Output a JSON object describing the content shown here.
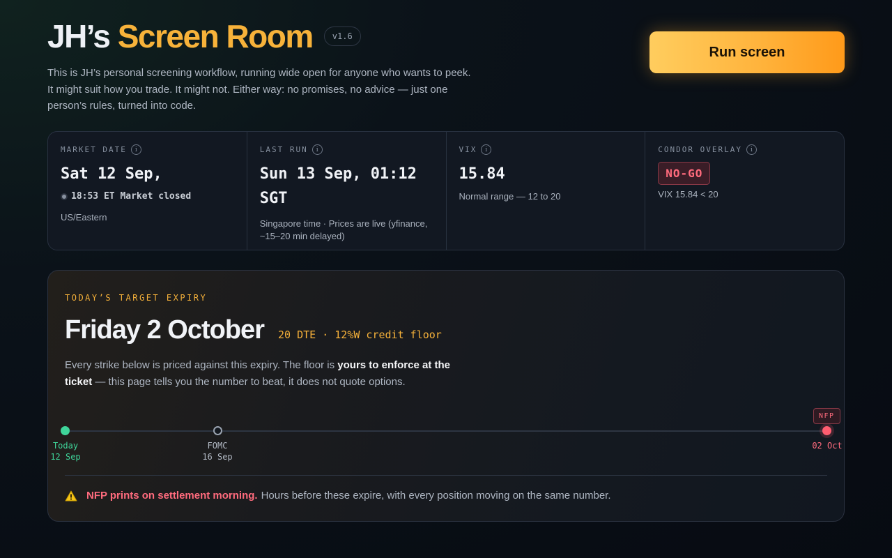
{
  "header": {
    "title_prefix": "JH’s",
    "title_accent": "Screen Room",
    "version": "v1.6",
    "intro": "This is JH’s personal screening workflow, running wide open for anyone who wants to peek. It might suit how you trade. It might not. Either way: no promises, no advice — just one person’s rules, turned into code."
  },
  "actions": {
    "run_label": "Run screen"
  },
  "stats": {
    "market_date": {
      "label": "MARKET DATE",
      "value": "Sat 12 Sep,",
      "status": "18:53 ET Market closed",
      "timezone": "US/Eastern"
    },
    "last_run": {
      "label": "LAST RUN",
      "value": "Sun 13 Sep, 01:12 SGT",
      "sub": "Singapore time · Prices are live (yfinance, ~15–20 min delayed)"
    },
    "vix": {
      "label": "VIX",
      "value": "15.84",
      "sub": "Normal range — 12 to 20"
    },
    "condor": {
      "label": "CONDOR OVERLAY",
      "badge": "NO-GO",
      "sub": "VIX 15.84 < 20"
    }
  },
  "expiry": {
    "label": "TODAY’S TARGET EXPIRY",
    "date": "Friday 2 October",
    "meta": "20 DTE · 12%W credit floor",
    "desc_before": "Every strike below is priced against this expiry. The floor is ",
    "desc_strong": "yours to enforce at the ticket",
    "desc_after": " — this page tells you the number to beat, it does not quote options.",
    "timeline": {
      "today_label": "Today",
      "today_date": "12 Sep",
      "fomc_label": "FOMC",
      "fomc_date": "16 Sep",
      "nfp_tag": "NFP",
      "nfp_date": "02 Oct"
    },
    "warning_strong": "NFP prints on settlement morning.",
    "warning_text": "Hours before these expire, with every position moving on the same number."
  },
  "colors": {
    "accent": "#f7b23a",
    "positive": "#3fd59a",
    "danger": "#ff6b7d"
  }
}
